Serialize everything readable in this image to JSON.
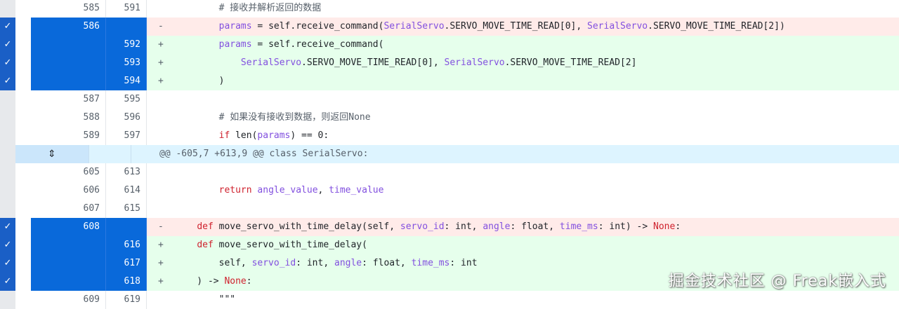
{
  "rows": [
    {
      "type": "ctx",
      "old": "585",
      "new": "591",
      "sign": "",
      "code": [
        {
          "t": "        # 接收并解析返回的数据",
          "c": "cm"
        }
      ]
    },
    {
      "type": "del",
      "sel": true,
      "old": "586",
      "new": "",
      "sign": "-",
      "code": [
        {
          "t": "        "
        },
        {
          "t": "params",
          "c": "prm"
        },
        {
          "t": " = self.receive_command("
        },
        {
          "t": "SerialServo",
          "c": "cls"
        },
        {
          "t": ".SERVO_MOVE_TIME_READ[0], "
        },
        {
          "t": "SerialServo",
          "c": "cls"
        },
        {
          "t": ".SERVO_MOVE_TIME_READ[2])"
        }
      ]
    },
    {
      "type": "add",
      "sel": true,
      "old": "",
      "new": "592",
      "sign": "+",
      "code": [
        {
          "t": "        "
        },
        {
          "t": "params",
          "c": "prm"
        },
        {
          "t": " = self.receive_command("
        }
      ]
    },
    {
      "type": "add",
      "sel": true,
      "old": "",
      "new": "593",
      "sign": "+",
      "code": [
        {
          "t": "            "
        },
        {
          "t": "SerialServo",
          "c": "cls"
        },
        {
          "t": ".SERVO_MOVE_TIME_READ[0], "
        },
        {
          "t": "SerialServo",
          "c": "cls"
        },
        {
          "t": ".SERVO_MOVE_TIME_READ[2]"
        }
      ]
    },
    {
      "type": "add",
      "sel": true,
      "old": "",
      "new": "594",
      "sign": "+",
      "code": [
        {
          "t": "        )"
        }
      ]
    },
    {
      "type": "ctx",
      "old": "587",
      "new": "595",
      "sign": "",
      "code": [
        {
          "t": ""
        }
      ]
    },
    {
      "type": "ctx",
      "old": "588",
      "new": "596",
      "sign": "",
      "code": [
        {
          "t": "        # 如果没有接收到数据，则返回None",
          "c": "cm"
        }
      ]
    },
    {
      "type": "ctx",
      "old": "589",
      "new": "597",
      "sign": "",
      "code": [
        {
          "t": "        "
        },
        {
          "t": "if",
          "c": "kw"
        },
        {
          "t": " len("
        },
        {
          "t": "params",
          "c": "prm"
        },
        {
          "t": ") == 0:"
        }
      ]
    },
    {
      "type": "hunk",
      "code": [
        {
          "t": "@@ -605,7 +613,9 @@ class SerialServo:"
        }
      ]
    },
    {
      "type": "ctx",
      "old": "605",
      "new": "613",
      "sign": "",
      "code": [
        {
          "t": ""
        }
      ]
    },
    {
      "type": "ctx",
      "old": "606",
      "new": "614",
      "sign": "",
      "code": [
        {
          "t": "        "
        },
        {
          "t": "return",
          "c": "kw"
        },
        {
          "t": " "
        },
        {
          "t": "angle_value",
          "c": "prm"
        },
        {
          "t": ", "
        },
        {
          "t": "time_value",
          "c": "prm"
        }
      ]
    },
    {
      "type": "ctx",
      "old": "607",
      "new": "615",
      "sign": "",
      "code": [
        {
          "t": ""
        }
      ]
    },
    {
      "type": "del",
      "sel": true,
      "old": "608",
      "new": "",
      "sign": "-",
      "code": [
        {
          "t": "    "
        },
        {
          "t": "def",
          "c": "kw"
        },
        {
          "t": " move_servo_with_time_delay(self, "
        },
        {
          "t": "servo_id",
          "c": "prm"
        },
        {
          "t": ": int, "
        },
        {
          "t": "angle",
          "c": "prm"
        },
        {
          "t": ": float, "
        },
        {
          "t": "time_ms",
          "c": "prm"
        },
        {
          "t": ": int) -> "
        },
        {
          "t": "None",
          "c": "kw"
        },
        {
          "t": ":"
        }
      ]
    },
    {
      "type": "add",
      "sel": true,
      "old": "",
      "new": "616",
      "sign": "+",
      "code": [
        {
          "t": "    "
        },
        {
          "t": "def",
          "c": "kw"
        },
        {
          "t": " move_servo_with_time_delay("
        }
      ]
    },
    {
      "type": "add",
      "sel": true,
      "old": "",
      "new": "617",
      "sign": "+",
      "code": [
        {
          "t": "        self, "
        },
        {
          "t": "servo_id",
          "c": "prm"
        },
        {
          "t": ": int, "
        },
        {
          "t": "angle",
          "c": "prm"
        },
        {
          "t": ": float, "
        },
        {
          "t": "time_ms",
          "c": "prm"
        },
        {
          "t": ": int"
        }
      ]
    },
    {
      "type": "add",
      "sel": true,
      "old": "",
      "new": "618",
      "sign": "+",
      "code": [
        {
          "t": "    ) -> "
        },
        {
          "t": "None",
          "c": "kw"
        },
        {
          "t": ":"
        }
      ]
    },
    {
      "type": "ctx",
      "old": "609",
      "new": "619",
      "sign": "",
      "code": [
        {
          "t": "        \"\"\""
        }
      ]
    }
  ],
  "watermark": "掘金技术社区 @ Freak嵌入式",
  "icons": {
    "check": "✓",
    "expand": "⇕"
  }
}
